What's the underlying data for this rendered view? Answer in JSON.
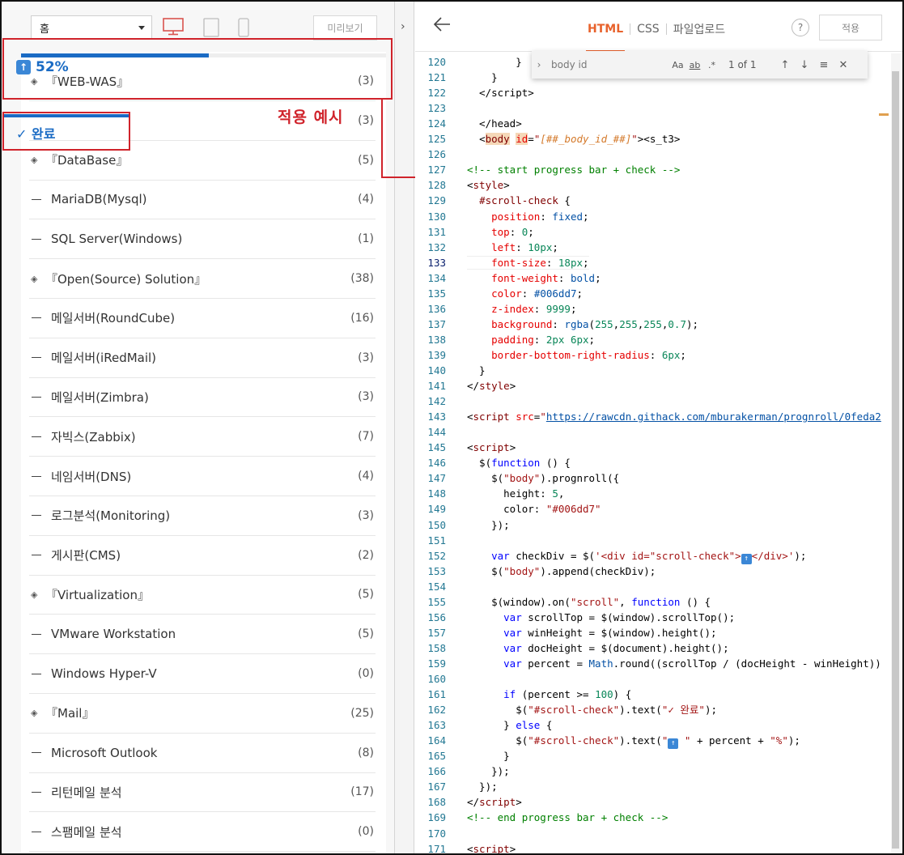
{
  "left_toolbar": {
    "home_select": "홈",
    "preview_label": "미리보기",
    "devices": [
      "desktop-icon",
      "tablet-icon",
      "mobile-icon"
    ]
  },
  "overlay": {
    "progress_percent": 52,
    "progress_text": "52%",
    "done_text": "✓ 완료",
    "example_label": "적용 예시",
    "accent_color": "#006dd7",
    "annotation_color": "#d0232b"
  },
  "categories": [
    {
      "marker": "diamond",
      "name": "『WEB-WAS』",
      "count": "(3)"
    },
    {
      "marker": "none",
      "name": "",
      "count": "(3)"
    },
    {
      "marker": "diamond",
      "name": "『DataBase』",
      "count": "(5)"
    },
    {
      "marker": "dash",
      "name": "MariaDB(Mysql)",
      "count": "(4)"
    },
    {
      "marker": "dash",
      "name": "SQL Server(Windows)",
      "count": "(1)"
    },
    {
      "marker": "diamond",
      "name": "『Open(Source) Solution』",
      "count": "(38)"
    },
    {
      "marker": "dash",
      "name": "메일서버(RoundCube)",
      "count": "(16)"
    },
    {
      "marker": "dash",
      "name": "메일서버(iRedMail)",
      "count": "(3)"
    },
    {
      "marker": "dash",
      "name": "메일서버(Zimbra)",
      "count": "(3)"
    },
    {
      "marker": "dash",
      "name": "자빅스(Zabbix)",
      "count": "(7)"
    },
    {
      "marker": "dash",
      "name": "네임서버(DNS)",
      "count": "(4)"
    },
    {
      "marker": "dash",
      "name": "로그분석(Monitoring)",
      "count": "(3)"
    },
    {
      "marker": "dash",
      "name": "게시판(CMS)",
      "count": "(2)"
    },
    {
      "marker": "diamond",
      "name": "『Virtualization』",
      "count": "(5)"
    },
    {
      "marker": "dash",
      "name": "VMware Workstation",
      "count": "(5)"
    },
    {
      "marker": "dash",
      "name": "Windows Hyper-V",
      "count": "(0)"
    },
    {
      "marker": "diamond",
      "name": "『Mail』",
      "count": "(25)"
    },
    {
      "marker": "dash",
      "name": "Microsoft Outlook",
      "count": "(8)"
    },
    {
      "marker": "dash",
      "name": "리턴메일 분석",
      "count": "(17)"
    },
    {
      "marker": "dash",
      "name": "스팸메일 분석",
      "count": "(0)"
    }
  ],
  "right_toolbar": {
    "tabs": [
      "HTML",
      "CSS",
      "파일업로드"
    ],
    "active_tab": "HTML",
    "help": "?",
    "apply_label": "적용"
  },
  "find": {
    "query": "body id",
    "opt_case": "Aa",
    "opt_word": "ab",
    "opt_regex": ".*",
    "count": "1 of 1"
  },
  "code": [
    {
      "n": "120",
      "h": "        }"
    },
    {
      "n": "121",
      "h": "    }"
    },
    {
      "n": "122",
      "h": "  &lt;/script&gt;"
    },
    {
      "n": "123",
      "h": ""
    },
    {
      "n": "124",
      "h": "  &lt;/head&gt;"
    },
    {
      "n": "125",
      "h": "  <span class='t-plain'>&lt;</span><span class='t-tag t-hl'>body</span> <span class='t-attr t-hl'>id</span>=<span class='t-str'>\"</span><span class='t-italic'>[##_body_id_##]</span><span class='t-str'>\"</span>&gt;&lt;s_t3&gt;"
    },
    {
      "n": "126",
      "h": ""
    },
    {
      "n": "127",
      "h": "<span class='t-com'>&lt;!-- start progress bar + check --&gt;</span>"
    },
    {
      "n": "128",
      "h": "&lt;<span class='t-tag'>style</span>&gt;"
    },
    {
      "n": "129",
      "h": "  <span class='t-tag'>#scroll-check</span> {"
    },
    {
      "n": "130",
      "h": "    <span class='t-attr'>position</span>: <span class='t-val'>fixed</span>;"
    },
    {
      "n": "131",
      "h": "    <span class='t-attr'>top</span>: <span class='t-num'>0</span>;"
    },
    {
      "n": "132",
      "h": "    <span class='t-attr'>left</span>: <span class='t-num'>10px</span>;"
    },
    {
      "n": "133",
      "h": "    <span class='t-attr'>font-size</span>: <span class='t-num'>18px</span>;",
      "cur": true
    },
    {
      "n": "134",
      "h": "    <span class='t-attr'>font-weight</span>: <span class='t-val'>bold</span>;"
    },
    {
      "n": "135",
      "h": "    <span class='t-attr'>color</span>: <span class='t-val'>#006dd7</span>;"
    },
    {
      "n": "136",
      "h": "    <span class='t-attr'>z-index</span>: <span class='t-num'>9999</span>;"
    },
    {
      "n": "137",
      "h": "    <span class='t-attr'>background</span>: <span class='t-val'>rgba</span>(<span class='t-num'>255</span>,<span class='t-num'>255</span>,<span class='t-num'>255</span>,<span class='t-num'>0.7</span>);"
    },
    {
      "n": "138",
      "h": "    <span class='t-attr'>padding</span>: <span class='t-num'>2px 6px</span>;"
    },
    {
      "n": "139",
      "h": "    <span class='t-attr'>border-bottom-right-radius</span>: <span class='t-num'>6px</span>;"
    },
    {
      "n": "140",
      "h": "  }"
    },
    {
      "n": "141",
      "h": "&lt;/<span class='t-tag'>style</span>&gt;"
    },
    {
      "n": "142",
      "h": ""
    },
    {
      "n": "143",
      "h": "&lt;<span class='t-tag'>script</span> <span class='t-attr'>src</span>=<span class='t-str'>\"</span><span class='t-link'>https://rawcdn.githack.com/mburakerman/prognroll/0feda2</span>"
    },
    {
      "n": "144",
      "h": ""
    },
    {
      "n": "145",
      "h": "&lt;<span class='t-tag'>script</span>&gt;"
    },
    {
      "n": "146",
      "h": "  $(<span class='t-kw'>function</span> () {"
    },
    {
      "n": "147",
      "h": "    $(<span class='t-str'>\"body\"</span>).prognroll({"
    },
    {
      "n": "148",
      "h": "      height: <span class='t-num'>5</span>,"
    },
    {
      "n": "149",
      "h": "      color: <span class='t-str'>\"#006dd7\"</span>"
    },
    {
      "n": "150",
      "h": "    });"
    },
    {
      "n": "151",
      "h": ""
    },
    {
      "n": "152",
      "h": "    <span class='t-kw'>var</span> checkDiv = $(<span class='t-str'>'&lt;div id=\"scroll-check\"&gt;</span><span class='emoji-sq'>↑</span><span class='t-str'>&lt;/div&gt;'</span>);"
    },
    {
      "n": "153",
      "h": "    $(<span class='t-str'>\"body\"</span>).append(checkDiv);"
    },
    {
      "n": "154",
      "h": ""
    },
    {
      "n": "155",
      "h": "    $(window).on(<span class='t-str'>\"scroll\"</span>, <span class='t-kw'>function</span> () {"
    },
    {
      "n": "156",
      "h": "      <span class='t-kw'>var</span> scrollTop = $(window).scrollTop();"
    },
    {
      "n": "157",
      "h": "      <span class='t-kw'>var</span> winHeight = $(window).height();"
    },
    {
      "n": "158",
      "h": "      <span class='t-kw'>var</span> docHeight = $(document).height();"
    },
    {
      "n": "159",
      "h": "      <span class='t-kw'>var</span> percent = <span class='t-val'>Math</span>.round((scrollTop / (docHeight - winHeight))"
    },
    {
      "n": "160",
      "h": ""
    },
    {
      "n": "161",
      "h": "      <span class='t-kw'>if</span> (percent &gt;= <span class='t-num'>100</span>) {"
    },
    {
      "n": "162",
      "h": "        $(<span class='t-str'>\"#scroll-check\"</span>).text(<span class='t-str'>\"✓ 완료\"</span>);"
    },
    {
      "n": "163",
      "h": "      } <span class='t-kw'>else</span> {"
    },
    {
      "n": "164",
      "h": "        $(<span class='t-str'>\"#scroll-check\"</span>).text(<span class='t-str'>\"</span><span class='emoji-sq'>↑</span><span class='t-str'> \"</span> + percent + <span class='t-str'>\"%\"</span>);"
    },
    {
      "n": "165",
      "h": "      }"
    },
    {
      "n": "166",
      "h": "    });"
    },
    {
      "n": "167",
      "h": "  });"
    },
    {
      "n": "168",
      "h": "&lt;/<span class='t-tag'>script</span>&gt;"
    },
    {
      "n": "169",
      "h": "<span class='t-com'>&lt;!-- end progress bar + check --&gt;</span>"
    },
    {
      "n": "170",
      "h": ""
    },
    {
      "n": "171",
      "h": "&lt;<span class='t-tag'>script</span>&gt;"
    }
  ]
}
